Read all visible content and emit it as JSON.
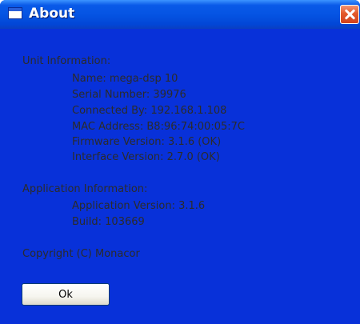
{
  "window": {
    "title": "About",
    "close_icon": "close-icon",
    "app_icon": "window-icon"
  },
  "unit_info": {
    "heading": "Unit Information:",
    "lines": [
      "Name: mega-dsp 10",
      "Serial Number: 39976",
      "Connected By: 192.168.1.108",
      "MAC Address: B8:96:74:00:05:7C",
      "Firmware Version: 3.1.6 (OK)",
      "Interface Version: 2.7.0 (OK)"
    ]
  },
  "app_info": {
    "heading": "Application Information:",
    "lines": [
      "Application Version: 3.1.6",
      "Build: 103669"
    ]
  },
  "copyright": "Copyright (C) Monacor",
  "ok_label": "Ok",
  "colors": {
    "title_bar": "#0554e3",
    "window_frame": "#0831d9",
    "client_bg": "#ece9d8",
    "close_button": "#e35a2b"
  }
}
